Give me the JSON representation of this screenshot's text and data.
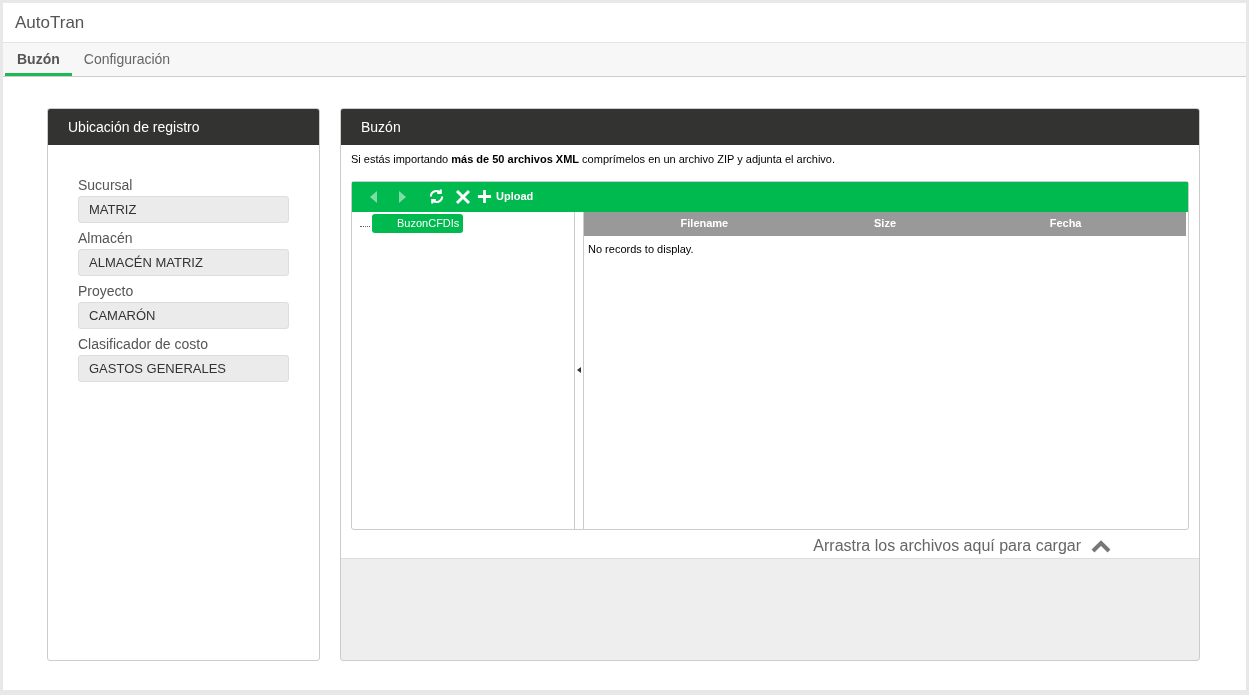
{
  "app_title": "AutoTran",
  "tabs": [
    {
      "label": "Buzón",
      "selected": true
    },
    {
      "label": "Configuración",
      "selected": false
    }
  ],
  "location_panel": {
    "title": "Ubicación de registro",
    "fields": [
      {
        "label": "Sucursal",
        "value": "MATRIZ"
      },
      {
        "label": "Almacén",
        "value": "ALMACÉN MATRIZ"
      },
      {
        "label": "Proyecto",
        "value": "CAMARÓN"
      },
      {
        "label": "Clasificador de costo",
        "value": "GASTOS GENERALES"
      }
    ]
  },
  "mailbox_panel": {
    "title": "Buzón",
    "notice": "Si estás importando **más de 50 archivos XML** comprímelos en un archivo ZIP y adjunta el archivo.",
    "toolbar": {
      "back_disabled": true,
      "forward_disabled": true,
      "upload_label": "Upload"
    },
    "tree": [
      {
        "label": "BuzonCFDIs",
        "selected": true
      }
    ],
    "columns": [
      "Filename",
      "Size",
      "Fecha"
    ],
    "empty_message": "No records to display.",
    "drop_hint": "Arrastra los archivos aquí para cargar"
  }
}
